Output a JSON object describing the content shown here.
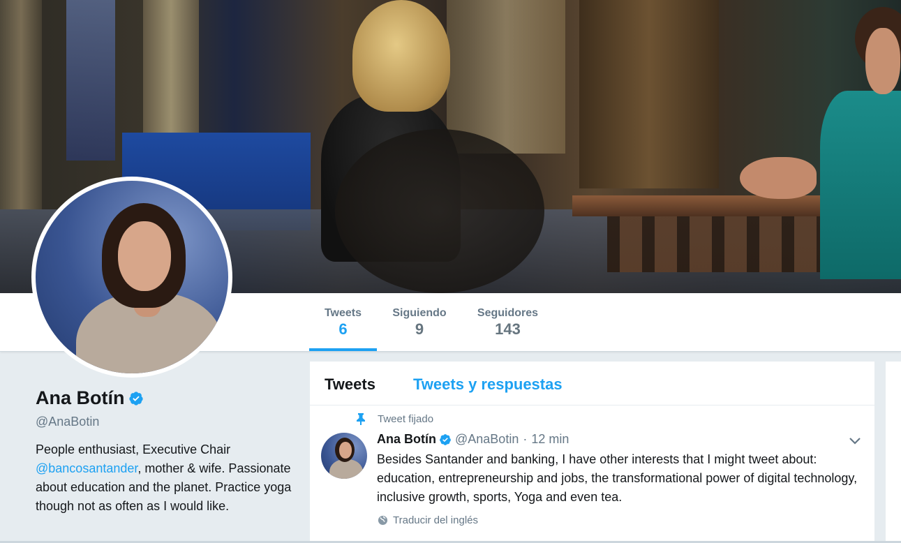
{
  "stats": {
    "tweets": {
      "label": "Tweets",
      "value": "6"
    },
    "following": {
      "label": "Siguiendo",
      "value": "9"
    },
    "followers": {
      "label": "Seguidores",
      "value": "143"
    }
  },
  "profile": {
    "name": "Ana Botín",
    "handle": "@AnaBotin",
    "bio_before_link": "People enthusiast, Executive Chair ",
    "bio_link": "@bancosantander",
    "bio_after_link": ", mother & wife. Passionate about education and the planet. Practice yoga though not as often as I would like."
  },
  "timeline": {
    "tabs": [
      "Tweets",
      "Tweets y respuestas"
    ],
    "pinned_label": "Tweet fijado",
    "tweet": {
      "name": "Ana Botín",
      "handle": "@AnaBotin",
      "separator": "·",
      "time": "12 min",
      "text": "Besides Santander and banking, I have other interests that I might tweet about: education, entrepreneurship and jobs, the transformational power of digital technology, inclusive growth, sports, Yoga and even tea.",
      "translate": "Traducir del inglés"
    }
  },
  "colors": {
    "accent": "#1da1f2",
    "text": "#14171a",
    "muted": "#657786",
    "background": "#e6ecf0"
  },
  "icons": [
    "verified-badge-icon",
    "pin-icon",
    "chevron-down-icon",
    "globe-icon"
  ]
}
